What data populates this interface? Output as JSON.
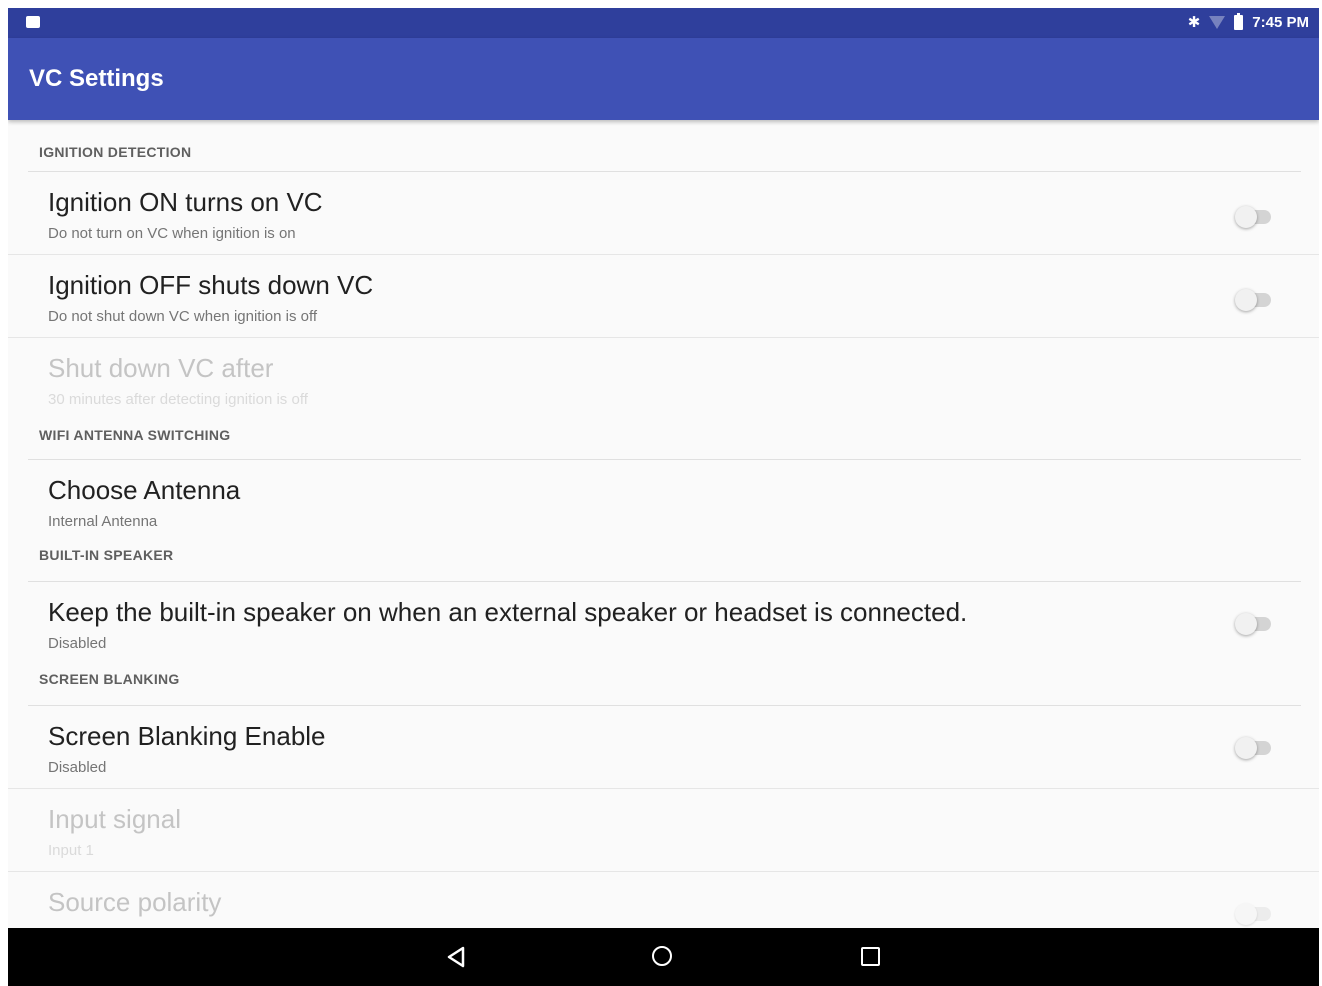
{
  "status_bar": {
    "time": "7:45 PM",
    "icons": [
      "notification-icon",
      "bluetooth-icon",
      "wifi-icon",
      "battery-icon"
    ]
  },
  "app_bar": {
    "title": "VC Settings",
    "color": "#3f51b5",
    "status_color": "#2f3f9c"
  },
  "sections": {
    "ignition": {
      "title": "IGNITION DETECTION",
      "on": {
        "title": "Ignition ON turns on VC",
        "summary": "Do not turn on VC when ignition is on",
        "enabled": false
      },
      "off": {
        "title": "Ignition OFF shuts down VC",
        "summary": "Do not shut down VC when ignition is off",
        "enabled": false
      },
      "shutdown_after": {
        "title": "Shut down VC after",
        "summary": "30 minutes after detecting ignition is off",
        "disabled": true
      }
    },
    "wifi": {
      "title": "WIFI ANTENNA SWITCHING",
      "choose": {
        "title": "Choose Antenna",
        "summary": "Internal Antenna"
      }
    },
    "speaker": {
      "title": "BUILT-IN SPEAKER",
      "keep_on": {
        "title": "Keep the built-in speaker on when an external speaker or headset is connected.",
        "summary": "Disabled",
        "enabled": false
      }
    },
    "blanking": {
      "title": "SCREEN BLANKING",
      "enable": {
        "title": "Screen Blanking Enable",
        "summary": "Disabled",
        "enabled": false
      },
      "input_signal": {
        "title": "Input signal",
        "summary": "Input 1",
        "disabled": true
      },
      "source_polarity": {
        "title": "Source polarity",
        "disabled": true,
        "enabled": false
      }
    }
  },
  "nav_bar": {
    "buttons": [
      "back-icon",
      "home-icon",
      "recents-icon"
    ]
  }
}
